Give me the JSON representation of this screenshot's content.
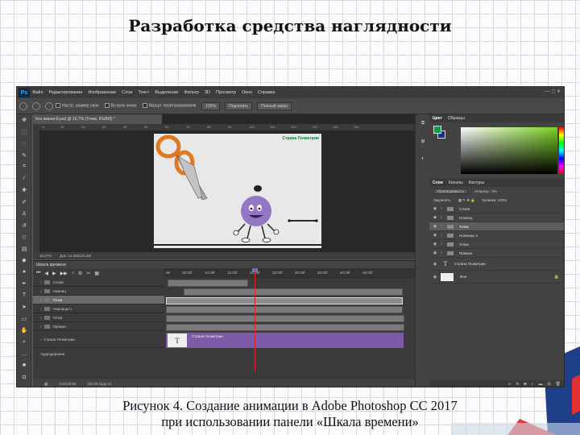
{
  "slide": {
    "title": "Разработка средства наглядности",
    "caption_line1": "Рисунок 4. Создание анимации в Adobe Photoshop CC 2017",
    "caption_line2": "при использовании панели «Шкала времени»"
  },
  "photoshop": {
    "logo": "Ps",
    "menu": [
      "Файл",
      "Редактирование",
      "Изображение",
      "Слои",
      "Текст",
      "Выделение",
      "Фильтр",
      "3D",
      "Просмотр",
      "Окно",
      "Справка"
    ],
    "window_controls": "—  ◻  ✕",
    "options_bar": {
      "resize_windows": "Настр. размер окон",
      "all_windows": "Во всех окнах",
      "scrubby_zoom": "Масшт. перетаскиванием",
      "zoom_btn": "100%",
      "fit_btn": "Подогнать",
      "fullscreen_btn": "Полный экран"
    },
    "document": {
      "tab_title": "Без имени-8.psd @ 16,7% (Точки, RGB/8) *",
      "ruler_ticks": [
        "0",
        "10",
        "20",
        "30",
        "40",
        "50",
        "60",
        "70",
        "80",
        "90",
        "100",
        "110",
        "120",
        "130",
        "140",
        "150"
      ],
      "canvas_text": "Страна Геометрии",
      "zoom_status": "16,67%",
      "doc_status": "Док: 12,4M/125,0M"
    },
    "timeline": {
      "panel_title": "Шкала времени",
      "ruler_labels": [
        "00",
        "05:00f",
        "10:00f",
        "15:00f",
        "20:00f",
        "25:00f",
        "30:00f",
        "35:00f",
        "40:00f",
        "45:00f"
      ],
      "tracks": [
        {
          "name": "Слова",
          "selected": false
        },
        {
          "name": "Ножниц",
          "selected": false
        },
        {
          "name": "Точки",
          "selected": true
        },
        {
          "name": "Ножницы н",
          "selected": false
        },
        {
          "name": "Точка",
          "selected": false
        },
        {
          "name": "Прямая",
          "selected": false
        }
      ],
      "text_track_name": "Страна Геометрии",
      "text_bar_label": "Страна Геометрии",
      "text_thumb": "T",
      "audio_track": "Аудиодорожка",
      "time_readout": "0:00:20:00",
      "fps_readout": "(30,00 кадр./с)"
    },
    "color_panel": {
      "tabs": [
        "Цвет",
        "Образцы"
      ],
      "fg_color": "#0e9d4a",
      "bg_color": "#1f2a85"
    },
    "layers_panel": {
      "tabs": [
        "Слои",
        "Каналы",
        "Контуры"
      ],
      "blend_mode": "Проницаемость",
      "opacity_label": "Непрозр.: 0%",
      "lock_label": "Закрепить:",
      "fill_label": "Заливка: 100%",
      "layers": [
        {
          "name": "Слова",
          "type": "group",
          "selected": false
        },
        {
          "name": "Ножниц",
          "type": "group",
          "selected": false
        },
        {
          "name": "Точки",
          "type": "group",
          "selected": true
        },
        {
          "name": "Ножницы н",
          "type": "group",
          "selected": false
        },
        {
          "name": "Точка",
          "type": "group",
          "selected": false
        },
        {
          "name": "Прямая",
          "type": "group",
          "selected": false
        },
        {
          "name": "Страна Геометрии",
          "type": "text",
          "selected": false
        },
        {
          "name": "Фон",
          "type": "background",
          "selected": false
        }
      ]
    }
  }
}
